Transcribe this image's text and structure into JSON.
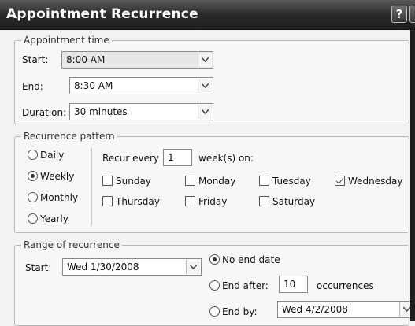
{
  "window": {
    "title": "Appointment Recurrence",
    "help_label": "?"
  },
  "appointment_time": {
    "legend": "Appointment time",
    "start_label": "Start:",
    "start_value": "8:00 AM",
    "end_label": "End:",
    "end_value": "8:30 AM",
    "duration_label": "Duration:",
    "duration_value": "30 minutes"
  },
  "recurrence_pattern": {
    "legend": "Recurrence pattern",
    "frequencies": [
      {
        "label": "Daily",
        "selected": false
      },
      {
        "label": "Weekly",
        "selected": true
      },
      {
        "label": "Monthly",
        "selected": false
      },
      {
        "label": "Yearly",
        "selected": false
      }
    ],
    "recur_every_label": "Recur every",
    "recur_every_value": "1",
    "weeks_on_label": "week(s) on:",
    "days": [
      {
        "label": "Sunday",
        "checked": false
      },
      {
        "label": "Monday",
        "checked": false
      },
      {
        "label": "Tuesday",
        "checked": false
      },
      {
        "label": "Wednesday",
        "checked": true
      },
      {
        "label": "Thursday",
        "checked": false
      },
      {
        "label": "Friday",
        "checked": false
      },
      {
        "label": "Saturday",
        "checked": false
      }
    ]
  },
  "range": {
    "legend": "Range of recurrence",
    "start_label": "Start:",
    "start_value": "Wed 1/30/2008",
    "no_end_label": "No end date",
    "end_after_label": "End after:",
    "end_after_value": "10",
    "occurrences_label": "occurrences",
    "end_by_label": "End by:",
    "end_by_value": "Wed 4/2/2008",
    "selected": "no_end"
  }
}
